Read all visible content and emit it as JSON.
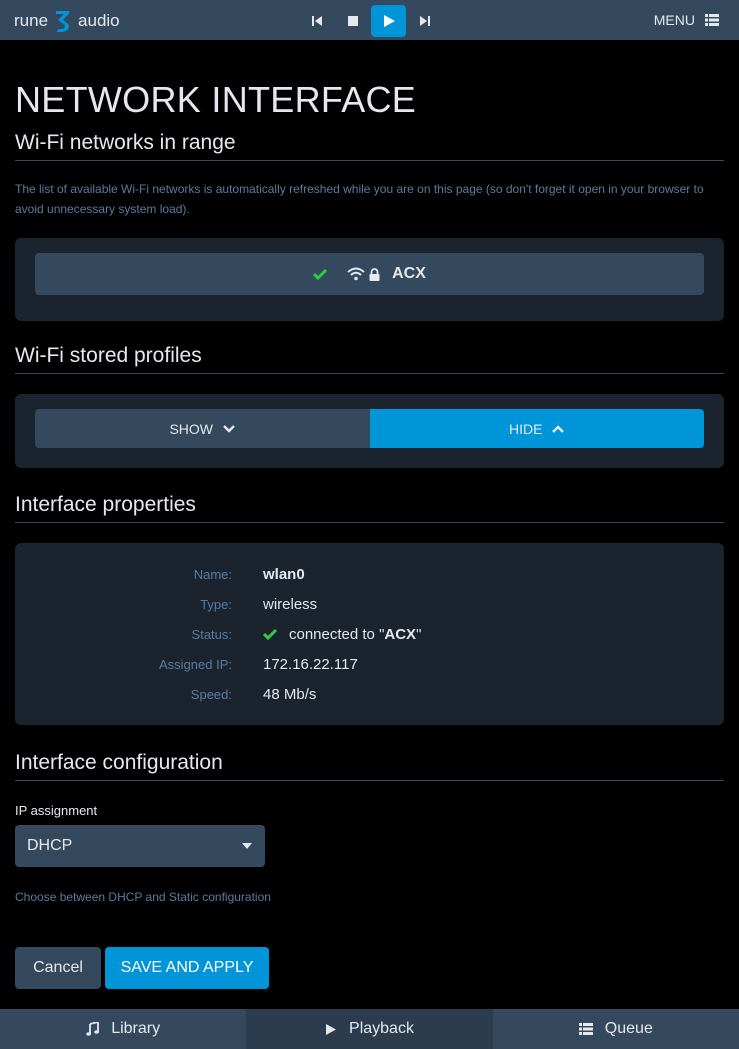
{
  "header": {
    "logo_left": "rune",
    "logo_right": "audio",
    "menu_label": "MENU",
    "transport": [
      "previous-icon",
      "stop-icon",
      "play-icon",
      "next-icon"
    ],
    "active_transport": "play"
  },
  "page": {
    "title": "NETWORK INTERFACE"
  },
  "wifi_range": {
    "title": "Wi-Fi networks in range",
    "help": "The list of available Wi-Fi networks is automatically refreshed while you are on this page (so don't forget it open in your browser to avoid unnecessary system load).",
    "networks": [
      {
        "ssid": "ACX",
        "connected": true,
        "secured": true
      }
    ]
  },
  "wifi_profiles": {
    "title": "Wi-Fi stored profiles",
    "show_label": "SHOW",
    "hide_label": "HIDE",
    "selected": "hide"
  },
  "interface_properties": {
    "title": "Interface properties",
    "name_label": "Name:",
    "name_value": "wlan0",
    "type_label": "Type:",
    "type_value": "wireless",
    "status_label": "Status:",
    "status_prefix": "connected to \"",
    "status_ssid": "ACX",
    "status_suffix": "\"",
    "ip_label": "Assigned IP:",
    "ip_value": "172.16.22.117",
    "speed_label": "Speed:",
    "speed_value": "48 Mb/s"
  },
  "interface_config": {
    "title": "Interface configuration",
    "ip_assignment_label": "IP assignment",
    "ip_assignment_value": "DHCP",
    "help": "Choose between DHCP and Static configuration",
    "cancel_label": "Cancel",
    "save_label": "SAVE AND APPLY"
  },
  "footer": {
    "library_label": "Library",
    "playback_label": "Playback",
    "queue_label": "Queue",
    "active": "playback"
  },
  "colors": {
    "accent": "#0095d8",
    "bar": "#34495e",
    "panel": "#1b242e",
    "help_text": "#587ca0",
    "success": "#2ecc40"
  }
}
